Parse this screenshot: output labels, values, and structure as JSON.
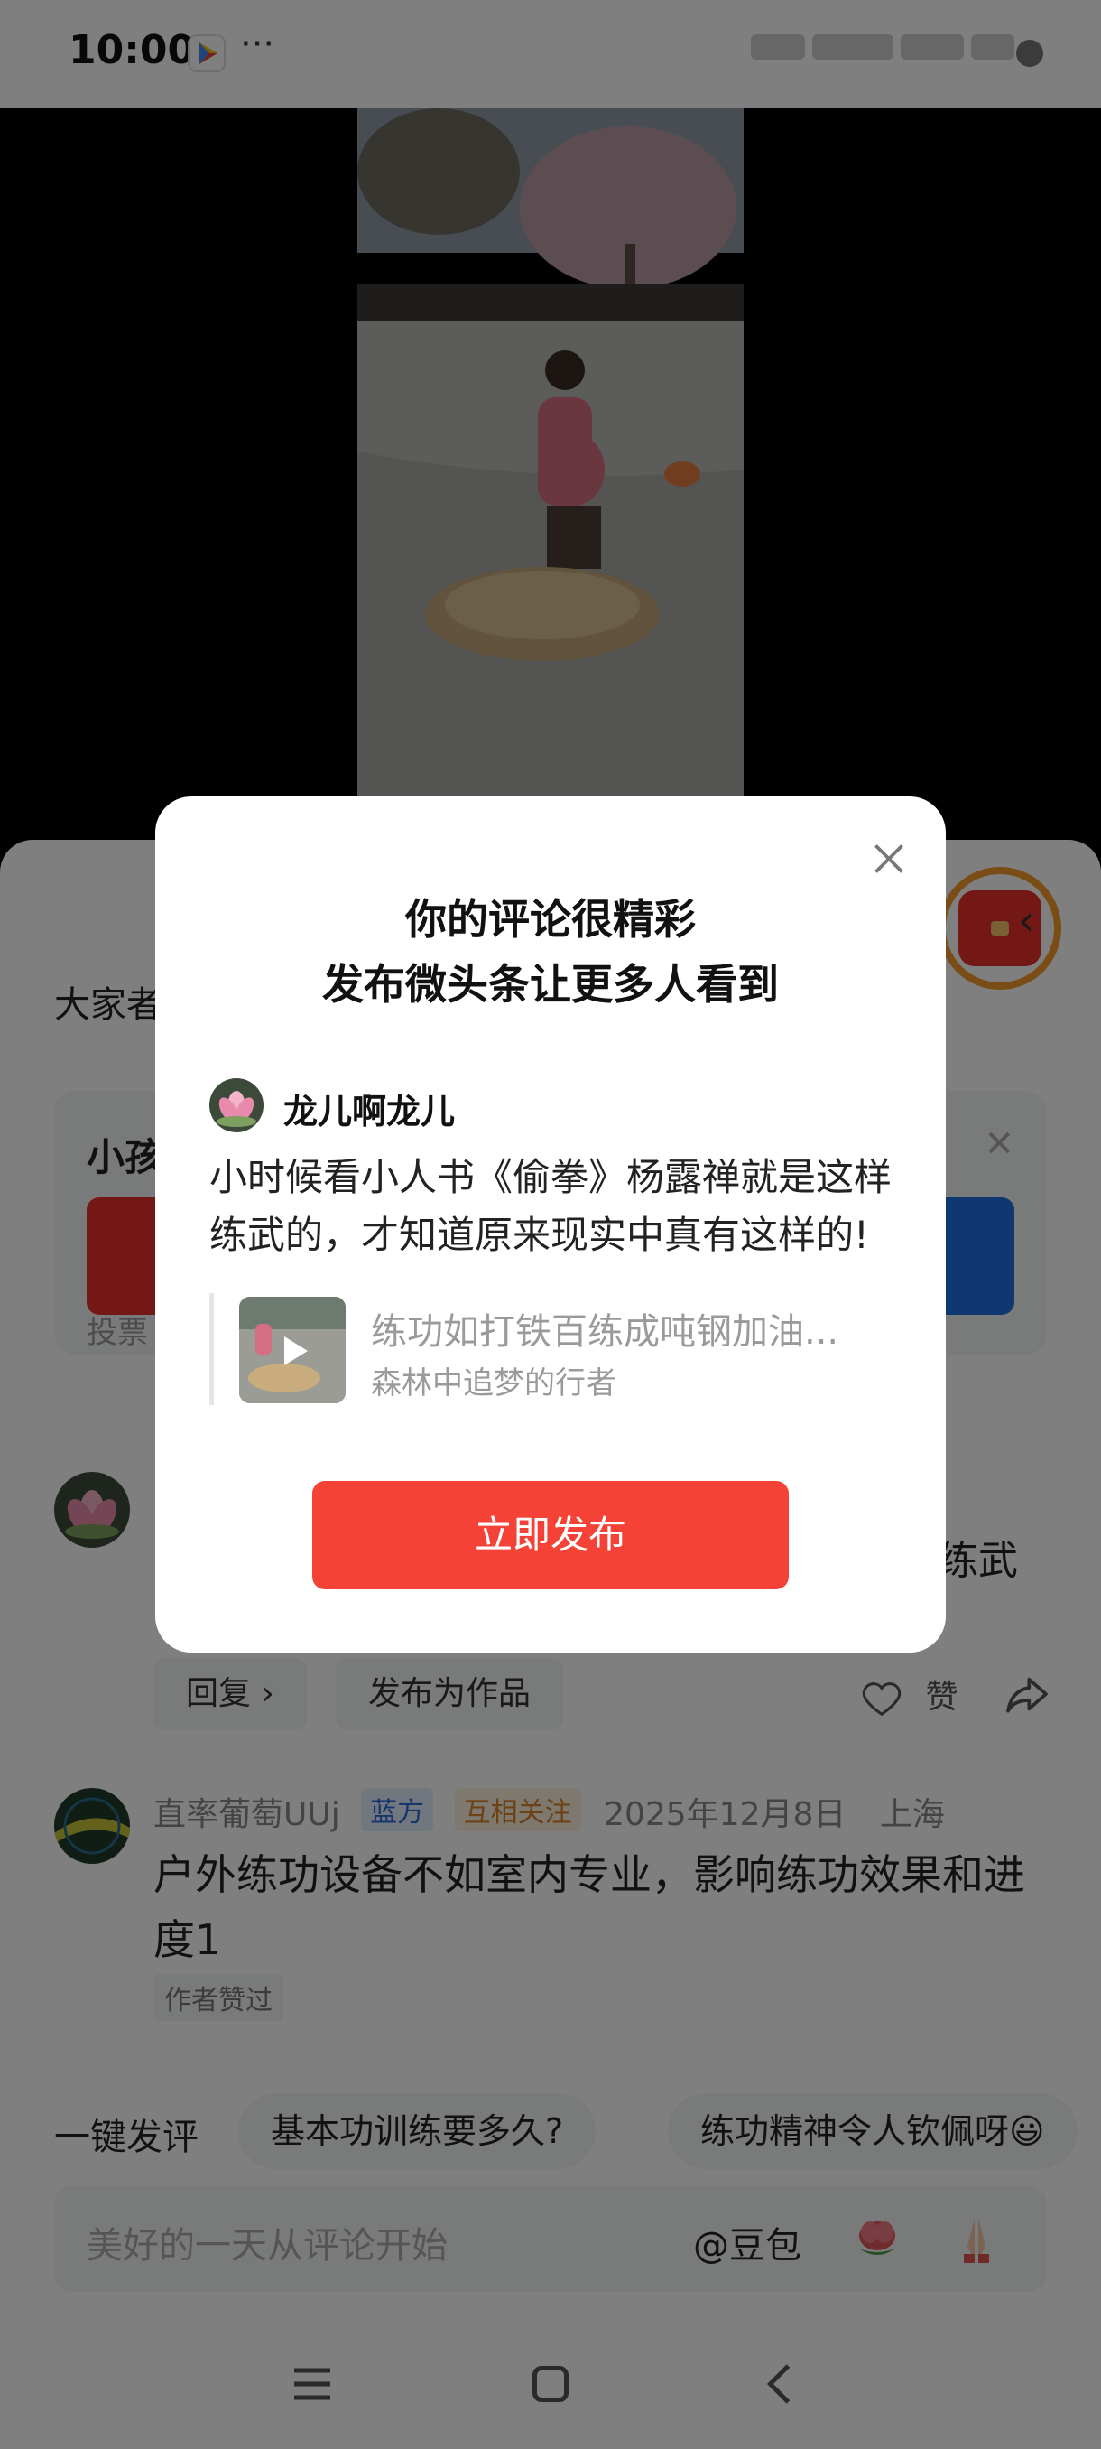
{
  "status_bar": {
    "time": "10:00",
    "more": "···"
  },
  "sheet": {
    "question_prefix": "大家者",
    "vote": {
      "title": "小孩",
      "footer": "投票"
    },
    "comment1": {
      "visible_text": "练武",
      "reply_label": "回复 ›",
      "publish_label": "发布为作品",
      "like_label": "赞"
    },
    "comment2": {
      "username": "直率葡萄UUj",
      "tag_blue": "蓝方",
      "tag_orange": "互相关注",
      "date": "2025年12月8日",
      "location": "上海",
      "body": "户外练功设备不如室内专业，影响练功效果和进度1",
      "badge": "作者赞过"
    },
    "quick_comment": {
      "label": "一键发评",
      "chips": [
        "基本功训练要多久?",
        "练功精神令人钦佩呀😃"
      ]
    },
    "input": {
      "placeholder": "美好的一天从评论开始",
      "at_label": "@豆包"
    }
  },
  "dialog": {
    "title_line1": "你的评论很精彩",
    "title_line2": "发布微头条让更多人看到",
    "username": "龙儿啊龙儿",
    "comment": "小时候看小人书《偷拳》杨露禅就是这样练武的，才知道原来现实中真有这样的!",
    "quote_title": "练功如打铁百练成吨钢加油...",
    "quote_author": "森林中追梦的行者",
    "publish_button": "立即发布"
  },
  "colors": {
    "accent_red": "#f44336",
    "vote_blue": "#1f6fe5",
    "vote_red": "#e8302d"
  },
  "icons": [
    "close-icon",
    "heart-icon",
    "share-icon",
    "menu-icon",
    "home-icon",
    "back-icon",
    "play-icon",
    "red-packet-icon"
  ]
}
